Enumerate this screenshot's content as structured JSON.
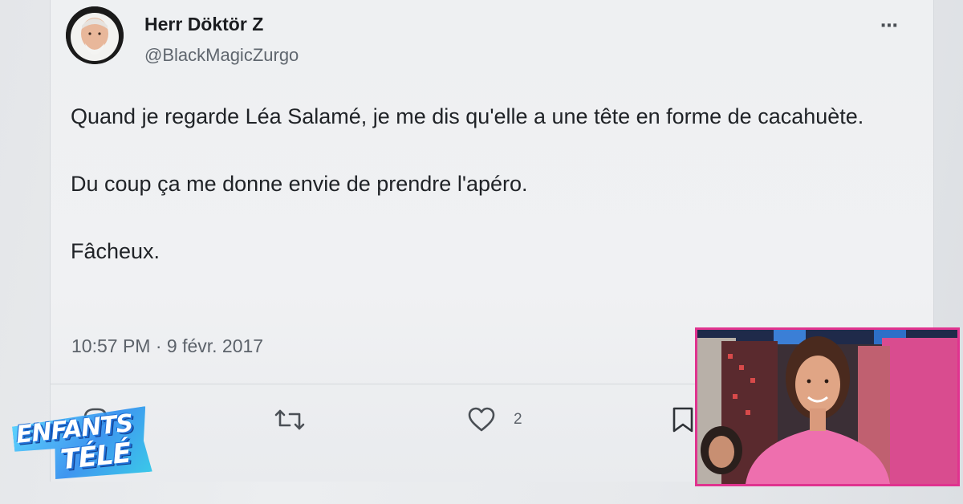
{
  "tweet": {
    "author_name": "Herr Döktör Z",
    "author_handle": "@BlackMagicZurgo",
    "more_icon": "⋯",
    "paragraphs": [
      "Quand je regarde Léa Salamé, je me dis qu'elle a une tête en forme de cacahuète.",
      "Du coup ça me donne envie de prendre l'apéro.",
      "Fâcheux."
    ],
    "timestamp": "10:57 PM · 9 févr. 2017",
    "actions": {
      "reply_icon": "reply-icon",
      "retweet_icon": "retweet-icon",
      "like_icon": "heart-icon",
      "like_count": "2",
      "bookmark_icon": "bookmark-icon"
    }
  },
  "overlay": {
    "logo_line1": "ENFANTS",
    "logo_line2": "TÉLÉ",
    "pip_border_color": "#e0338f",
    "logo_color": "#2c8cf0"
  }
}
